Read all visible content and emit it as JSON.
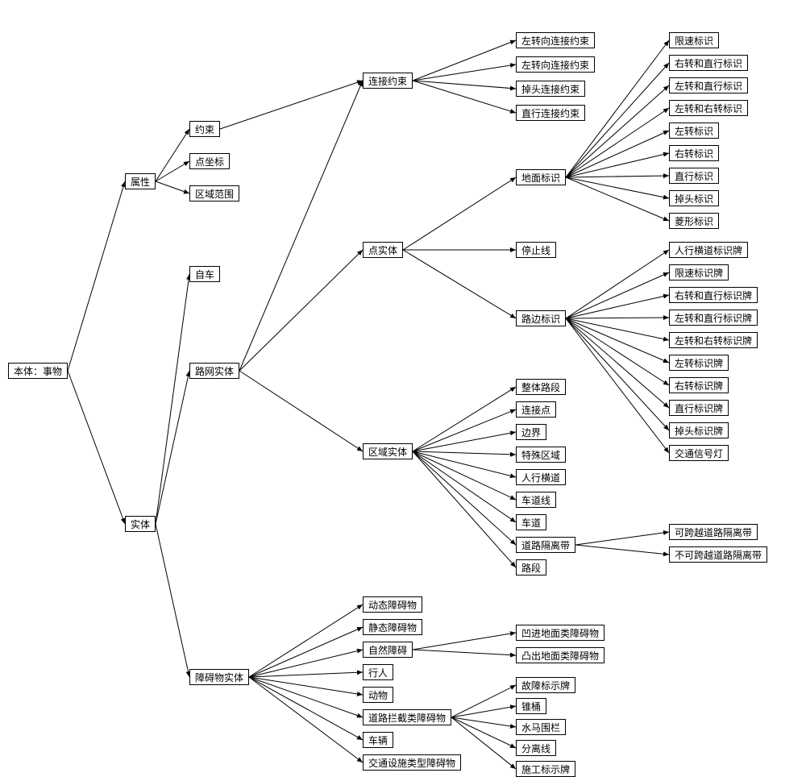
{
  "root": "本体：事物",
  "attr": {
    "label": "属性",
    "children": [
      "约束",
      "点坐标",
      "区域范围"
    ]
  },
  "entity": {
    "label": "实体",
    "children": [
      "自车",
      "路网实体",
      "障碍物实体"
    ]
  },
  "roadnet": {
    "conn_constraint": {
      "label": "连接约束",
      "children": [
        "左转向连接约束",
        "左转向连接约束",
        "掉头连接约束",
        "直行连接约束"
      ]
    },
    "point_entity": {
      "label": "点实体",
      "children_labels": [
        "地面标识",
        "停止线",
        "路边标识"
      ]
    },
    "ground_marks": [
      "限速标识",
      "右转和直行标识",
      "左转和直行标识",
      "左转和右转标识",
      "左转标识",
      "右转标识",
      "直行标识",
      "掉头标识",
      "菱形标识"
    ],
    "roadside_marks": [
      "人行横道标识牌",
      "限速标识牌",
      "右转和直行标识牌",
      "左转和直行标识牌",
      "左转和右转标识牌",
      "左转标识牌",
      "右转标识牌",
      "直行标识牌",
      "掉头标识牌",
      "交通信号灯"
    ],
    "area_entity": {
      "label": "区域实体",
      "children": [
        "整体路段",
        "连接点",
        "边界",
        "特殊区域",
        "人行横道",
        "车道线",
        "车道",
        "道路隔离带",
        "路段"
      ]
    },
    "separator": [
      "可跨越道路隔离带",
      "不可跨越道路隔离带"
    ]
  },
  "obstacle": {
    "label": "障碍物实体",
    "children": [
      "动态障碍物",
      "静态障碍物",
      "自然障碍",
      "行人",
      "动物",
      "道路拦截类障碍物",
      "车辆",
      "交通设施类型障碍物"
    ],
    "natural": [
      "凹进地面类障碍物",
      "凸出地面类障碍物"
    ],
    "block": [
      "故障标示牌",
      "锥桶",
      "水马围栏",
      "分离线",
      "施工标示牌"
    ]
  }
}
